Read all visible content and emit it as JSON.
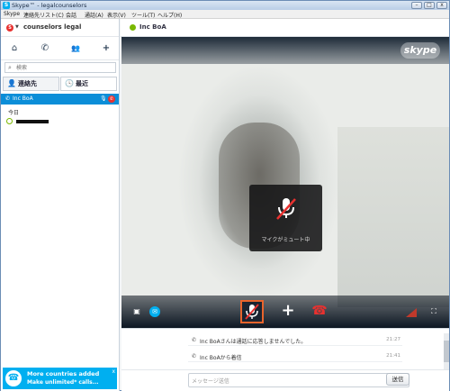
{
  "window": {
    "title": "Skype™ - legalcounselors",
    "logo_letter": "S",
    "minimize": "–",
    "maximize": "□",
    "close": "x"
  },
  "menu": [
    "Skype",
    "連絡先リスト(C)",
    "会話",
    "通話(A)",
    "表示(V)",
    "ツール(T)",
    "ヘルプ(H)"
  ],
  "sidebar": {
    "profile_name": "counselors legal",
    "profile_icon": "skype-status-icon",
    "actions": [
      {
        "name": "home-icon",
        "glyph": "⌂"
      },
      {
        "name": "call-icon",
        "glyph": "✆"
      },
      {
        "name": "contacts-group-icon",
        "glyph": "👥"
      },
      {
        "name": "add-contact-icon",
        "glyph": "+"
      }
    ],
    "search_placeholder": "検索",
    "tabs": [
      {
        "label": "連絡先",
        "icon": "contact-icon",
        "glyph": "👤",
        "active": false
      },
      {
        "label": "最近",
        "icon": "clock-icon",
        "glyph": "🕓",
        "active": true
      }
    ],
    "active_call": {
      "name": "Inc BoA"
    },
    "today_label": "今日",
    "promo": {
      "line1": "More countries added",
      "line2": "Make unlimited* calls...",
      "close": "x"
    }
  },
  "conversation": {
    "contact_name": "Inc BoA",
    "status_color": "#7ab800",
    "video": {
      "brand": "skype",
      "mute_label": "マイクがミュート中"
    },
    "messages": [
      {
        "text": "Inc BoAさんは通話に応答しませんでした。",
        "time": "21:27"
      },
      {
        "text": "Inc BoAから着信",
        "time": "21:41"
      }
    ],
    "composer": {
      "placeholder": "メッセージ送信",
      "send_label": "送信"
    }
  },
  "colors": {
    "accent": "#00aff0",
    "selection": "#0b8ed8",
    "hangup": "#e8312f",
    "mute_border": "#e8642c"
  }
}
